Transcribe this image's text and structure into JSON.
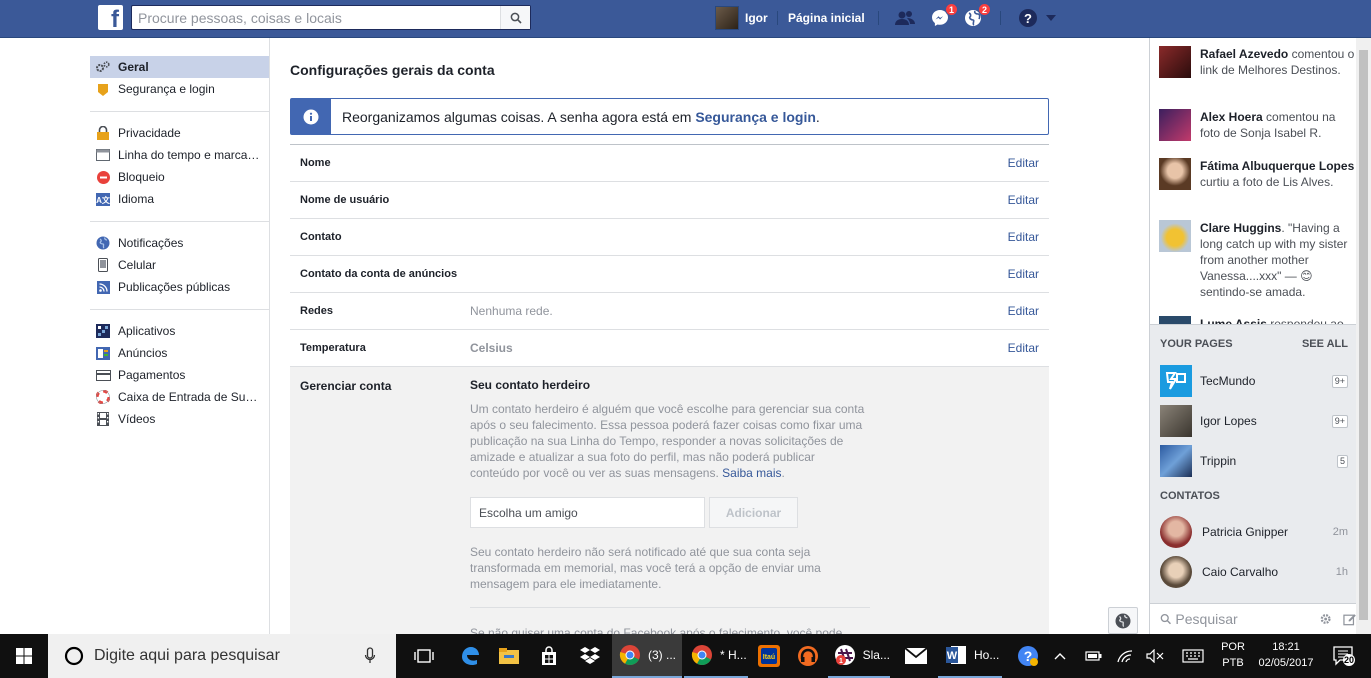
{
  "topbar": {
    "search_placeholder": "Procure pessoas, coisas e locais",
    "user_name": "Igor",
    "home_label": "Página inicial",
    "messages_badge": "1",
    "notifications_badge": "2"
  },
  "leftnav": {
    "group1": [
      {
        "label": "Geral",
        "icon": "gear-icon"
      },
      {
        "label": "Segurança e login",
        "icon": "badge-icon"
      }
    ],
    "group2": [
      {
        "label": "Privacidade",
        "icon": "lock-icon"
      },
      {
        "label": "Linha do tempo e marca…",
        "icon": "timeline-icon"
      },
      {
        "label": "Bloqueio",
        "icon": "block-icon"
      },
      {
        "label": "Idioma",
        "icon": "language-icon"
      }
    ],
    "group3": [
      {
        "label": "Notificações",
        "icon": "globe-icon"
      },
      {
        "label": "Celular",
        "icon": "phone-icon"
      },
      {
        "label": "Publicações públicas",
        "icon": "rss-icon"
      }
    ],
    "group4": [
      {
        "label": "Aplicativos",
        "icon": "apps-icon"
      },
      {
        "label": "Anúncios",
        "icon": "ads-icon"
      },
      {
        "label": "Pagamentos",
        "icon": "card-icon"
      },
      {
        "label": "Caixa de Entrada de Su…",
        "icon": "lifebuoy-icon"
      },
      {
        "label": "Vídeos",
        "icon": "film-icon"
      }
    ]
  },
  "main": {
    "title": "Configurações gerais da conta",
    "notice_text": "Reorganizamos algumas coisas. A senha agora está em ",
    "notice_link": "Segurança e login",
    "notice_end": ".",
    "edit_label": "Editar",
    "rows": [
      {
        "label": "Nome",
        "value": ""
      },
      {
        "label": "Nome de usuário",
        "value": ""
      },
      {
        "label": "Contato",
        "value": ""
      },
      {
        "label": "Contato da conta de anúncios",
        "value": ""
      },
      {
        "label": "Redes",
        "value": "Nenhuma rede."
      },
      {
        "label": "Temperatura",
        "value": "Celsius"
      }
    ],
    "manage": {
      "label": "Gerenciar conta",
      "heading": "Seu contato herdeiro",
      "desc": "Um contato herdeiro é alguém que você escolhe para gerenciar sua conta após o seu falecimento. Essa pessoa poderá fazer coisas como fixar uma publicação na sua Linha do Tempo, responder a novas solicitações de amizade e atualizar a sua foto do perfil, mas não poderá publicar conteúdo por você ou ver as suas mensagens. ",
      "learn_more": "Saiba mais",
      "desc_end": ".",
      "friend_placeholder": "Escolha um amigo",
      "add_button": "Adicionar",
      "note": "Seu contato herdeiro não será notificado até que sua conta seja transformada em memorial, mas você terá a opção de enviar uma mensagem para ele imediatamente.",
      "cut_text": "Se não quiser uma conta do Facebook após o falecimento, você pode"
    }
  },
  "ticker": [
    {
      "name": "Rafael Azevedo",
      "text": " comentou o link de Melhores Destinos."
    },
    {
      "name": "Alex Hoera",
      "text": " comentou na foto de Sonja Isabel R."
    },
    {
      "name": "Fátima Albuquerque Lopes",
      "text": " curtiu a foto de Lis Alves."
    },
    {
      "name": "Clare Huggins",
      "text": ". \"Having a long catch up with my sister from another mother Vanessa....xxx\" — 😊 sentindo-se amada."
    },
    {
      "name": "Lume Assis",
      "text": " respondeu ao"
    }
  ],
  "your_pages": {
    "title": "YOUR PAGES",
    "see_all": "SEE ALL",
    "items": [
      {
        "name": "TecMundo",
        "count": "9+"
      },
      {
        "name": "Igor Lopes",
        "count": "9+"
      },
      {
        "name": "Trippin",
        "count": "5"
      }
    ]
  },
  "contacts": {
    "title": "CONTATOS",
    "items": [
      {
        "name": "Patricia Gnipper",
        "time": "2m"
      },
      {
        "name": "Caio Carvalho",
        "time": "1h"
      }
    ],
    "search_placeholder": "Pesquisar"
  },
  "taskbar": {
    "search_placeholder": "Digite aqui para pesquisar",
    "apps": [
      {
        "label": "(3) ...",
        "icon": "chrome-icon"
      },
      {
        "label": "* H...",
        "icon": "chrome-icon"
      },
      {
        "label": "Sla...",
        "icon": "slack-icon"
      },
      {
        "label": "Ho...",
        "icon": "word-icon"
      }
    ],
    "lang_top": "POR",
    "lang_bottom": "PTB",
    "time": "18:21",
    "date": "02/05/2017",
    "notif_count": "20"
  },
  "colors": {
    "brand": "#3b5998",
    "link": "#365899",
    "notice_border": "#4267b2"
  }
}
